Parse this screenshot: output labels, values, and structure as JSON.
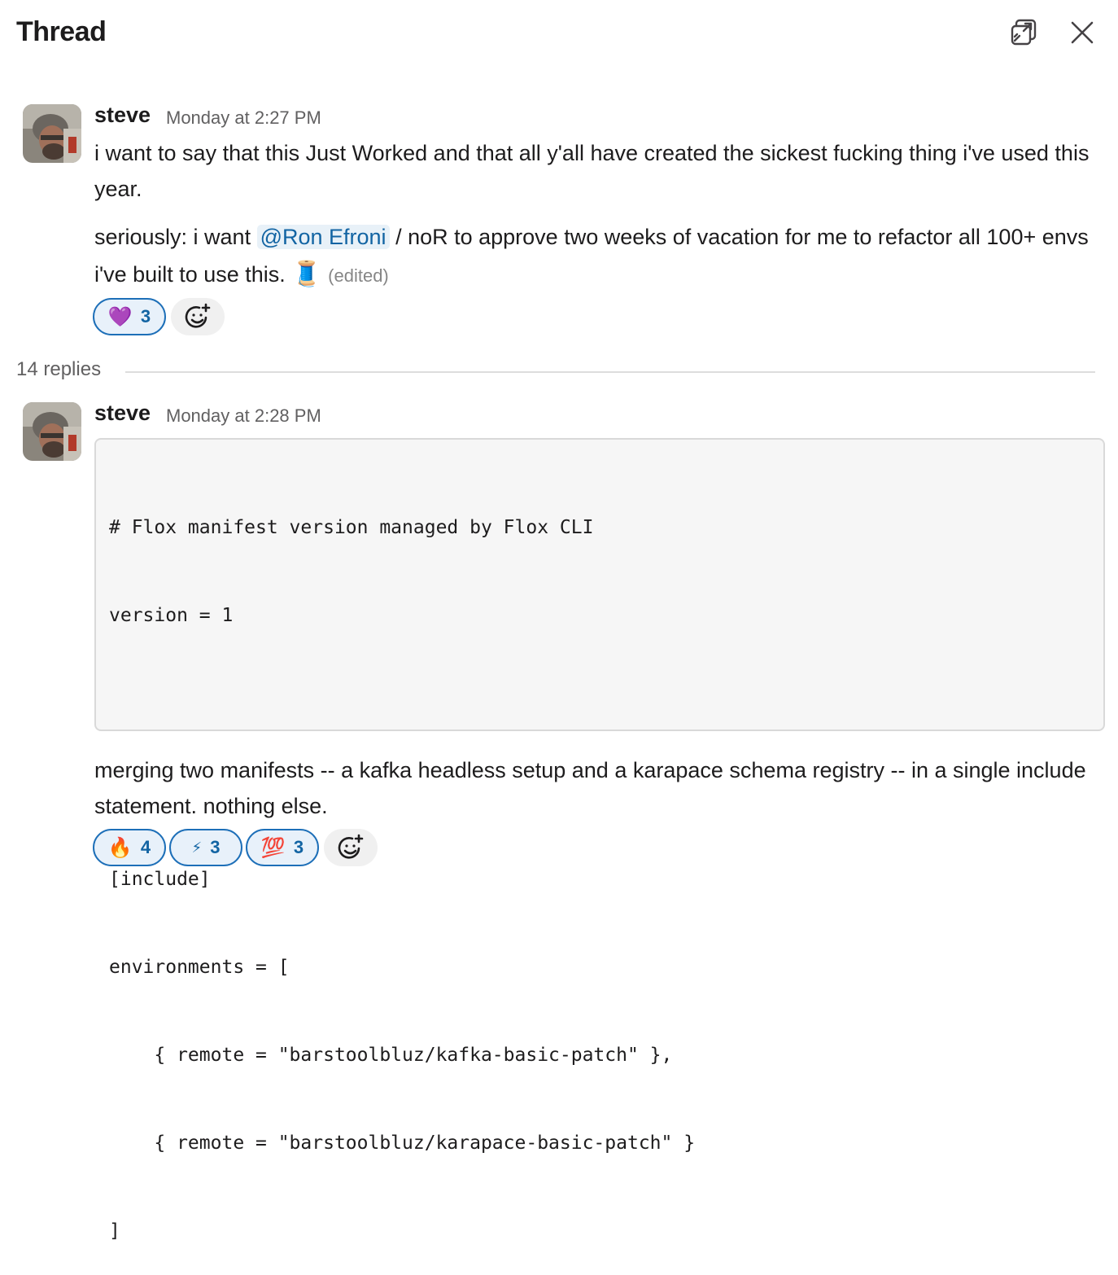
{
  "header": {
    "title": "Thread",
    "popout_icon": "popout-window-icon",
    "close_icon": "close-icon"
  },
  "message1": {
    "author": "steve",
    "timestamp": "Monday at 2:27 PM",
    "paragraph1": "i want to say that this Just Worked and that all y'all have created the sickest fucking thing i've used this year.",
    "p2_prefix": "seriously: i want ",
    "mention": "@Ron Efroni",
    "p2_mid": " / noR to approve two weeks of vacation for me to refactor all 100+ envs i've built to use this. ",
    "emoji": "🧵",
    "edited": "(edited)",
    "reactions": [
      {
        "emoji": "💜",
        "count": "3"
      }
    ],
    "add_reaction_icon": "add-reaction-icon"
  },
  "thread": {
    "replies_label": "14 replies"
  },
  "message2": {
    "author": "steve",
    "timestamp": "Monday at 2:28 PM",
    "code_lines": [
      "# Flox manifest version managed by Flox CLI",
      "version = 1",
      "",
      "",
      "[include]",
      "environments = [",
      "    { remote = \"barstoolbluz/kafka-basic-patch\" },",
      "    { remote = \"barstoolbluz/karapace-basic-patch\" }",
      "]"
    ],
    "text": "merging two manifests -- a kafka headless setup and a karapace schema registry -- in a single include statement. nothing else.",
    "reactions": [
      {
        "emoji": "🔥",
        "count": "4"
      },
      {
        "emoji": "⚡",
        "count": "3"
      },
      {
        "emoji": "💯",
        "count": "3"
      }
    ],
    "add_reaction_icon": "add-reaction-icon"
  },
  "colors": {
    "mention_bg": "#e8f1f8",
    "mention_text": "#1264a3",
    "reaction_border": "#1d6fb8"
  }
}
